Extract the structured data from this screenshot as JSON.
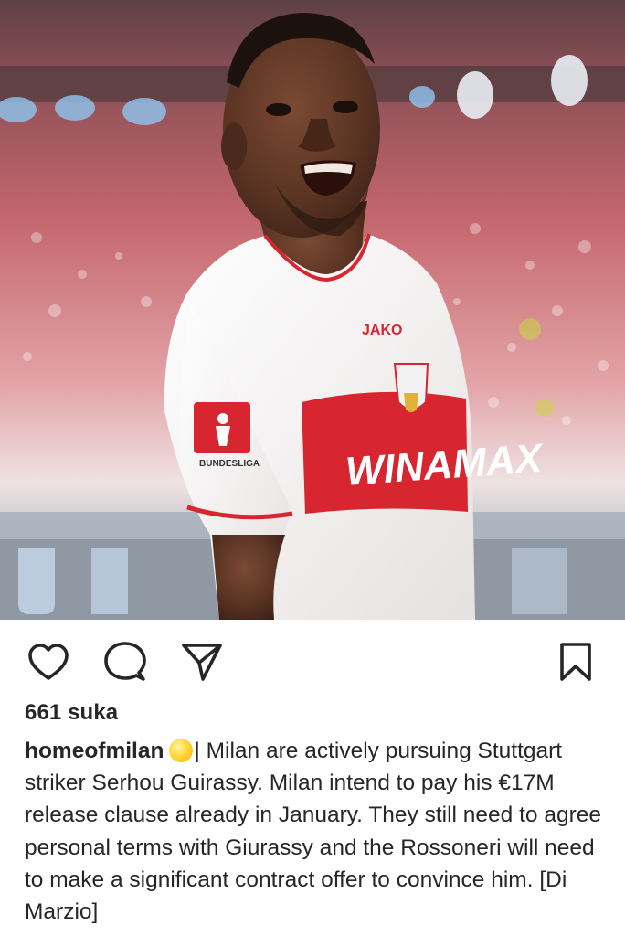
{
  "post": {
    "image": {
      "subject": "football-player-photo",
      "kit_sponsor": "WINAMAX",
      "kit_brand": "JAKO",
      "sleeve_badge": "BUNDESLIGA",
      "colors": {
        "shirt": "#f4f1f0",
        "band": "#d7262f",
        "skin": "#5a3424",
        "crowd": "#c0666c"
      }
    },
    "actions": {
      "like_icon": "heart-outline-icon",
      "comment_icon": "comment-bubble-icon",
      "share_icon": "paper-plane-icon",
      "save_icon": "bookmark-outline-icon"
    },
    "likes_label": "661 suka",
    "caption": {
      "username": "homeofmilan",
      "emoji": "yellow-circle-emoji",
      "text": "| Milan are actively pursuing Stuttgart striker Serhou Guirassy. Milan intend to pay his €17M release clause already in January. They still need to agree personal terms with Giurassy and the Rossoneri will need to make a significant contract offer to convince him. [Di Marzio]"
    }
  },
  "theme": {
    "text": "#262626",
    "background": "#ffffff"
  }
}
